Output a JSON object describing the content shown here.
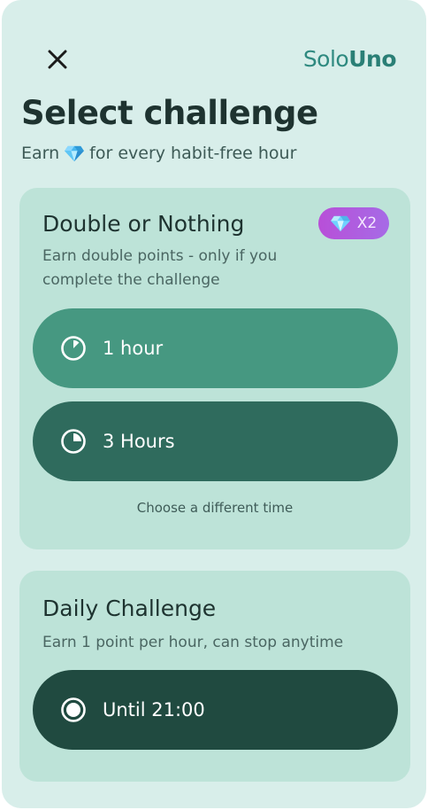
{
  "header": {
    "logo_part1": "Solo",
    "logo_part2": "Uno"
  },
  "page": {
    "title": "Select challenge",
    "subtitle_before": "Earn",
    "subtitle_after": "for every habit-free hour"
  },
  "double_card": {
    "title": "Double or Nothing",
    "description": "Earn double points - only if you complete the challenge",
    "badge_label": "X2",
    "options": [
      {
        "label": "1 hour",
        "icon": "timer-1-icon"
      },
      {
        "label": "3 Hours",
        "icon": "timer-3-icon"
      }
    ],
    "different_time_label": "Choose a different time"
  },
  "daily_card": {
    "title": "Daily Challenge",
    "description": "Earn 1 point per hour, can stop anytime",
    "option_label": "Until 21:00",
    "option_icon": "radio-selected-icon"
  },
  "colors": {
    "background": "#d8eeea",
    "card": "#bde3d8",
    "option_light": "#469881",
    "option_mid": "#2f6b5d",
    "option_dark": "#204a40",
    "brand": "#2f8a80",
    "badge_gradient_start": "#b84fd8",
    "badge_gradient_end": "#a66be6"
  }
}
